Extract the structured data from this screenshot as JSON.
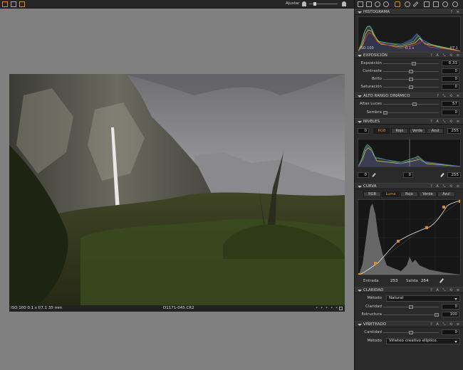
{
  "topbar": {
    "adjust_label": "Ajustar"
  },
  "photo": {
    "status_left": "ISO 100   0.1 s   f/7.1   35 mm",
    "filename": "D1171-045.CR2"
  },
  "histogram": {
    "title": "HISTOGRAMA",
    "iso": "ISO 100",
    "shutter": "0.1 s",
    "aperture": "f/7.1"
  },
  "exposure": {
    "title": "EXPOSICIÓN",
    "rows": [
      {
        "label": "Exposición",
        "value": "0,33",
        "level": 0.55
      },
      {
        "label": "Contraste",
        "value": "0",
        "level": 0.5
      },
      {
        "label": "Brillo",
        "value": "0",
        "level": 0.5
      },
      {
        "label": "Saturación",
        "value": "0",
        "level": 0.5
      }
    ]
  },
  "hdr": {
    "title": "ALTO RANGO DINÁMICO",
    "rows": [
      {
        "label": "Altas Luces",
        "value": "57",
        "level": 0.57
      },
      {
        "label": "Sombra",
        "value": "0",
        "level": 0.0
      }
    ]
  },
  "levels": {
    "title": "NIVELES",
    "left_value": "0",
    "right_value": "255",
    "tabs": [
      "RGB",
      "Rojo",
      "Verde",
      "Azul"
    ],
    "active_tab": "RGB",
    "bottom_left": "0",
    "bottom_mid": "0",
    "bottom_right": "255"
  },
  "curve": {
    "title": "CURVA",
    "tabs": [
      "RGB",
      "Luma",
      "Rojo",
      "Verde",
      "Azul"
    ],
    "active_tab": "Luma",
    "input_label": "Entrada",
    "input_value": "253",
    "output_label": "Salida",
    "output_value": "254"
  },
  "clarity": {
    "title": "CLARIDAD",
    "method_label": "Método",
    "method_value": "Natural",
    "rows": [
      {
        "label": "Claridad",
        "value": "0",
        "level": 0.5
      },
      {
        "label": "Estructura",
        "value": "100",
        "level": 1.0
      }
    ]
  },
  "vignette": {
    "title": "VIÑETEADO",
    "amount_label": "Cantidad",
    "amount_value": "0",
    "amount_level": 0.5,
    "method_label": "Método",
    "method_value": "Viñeteo creativo elíptico."
  },
  "colors": {
    "accent": "#e08a1a",
    "panel_bg": "#2a2a2a",
    "viewer_bg": "#808080"
  }
}
